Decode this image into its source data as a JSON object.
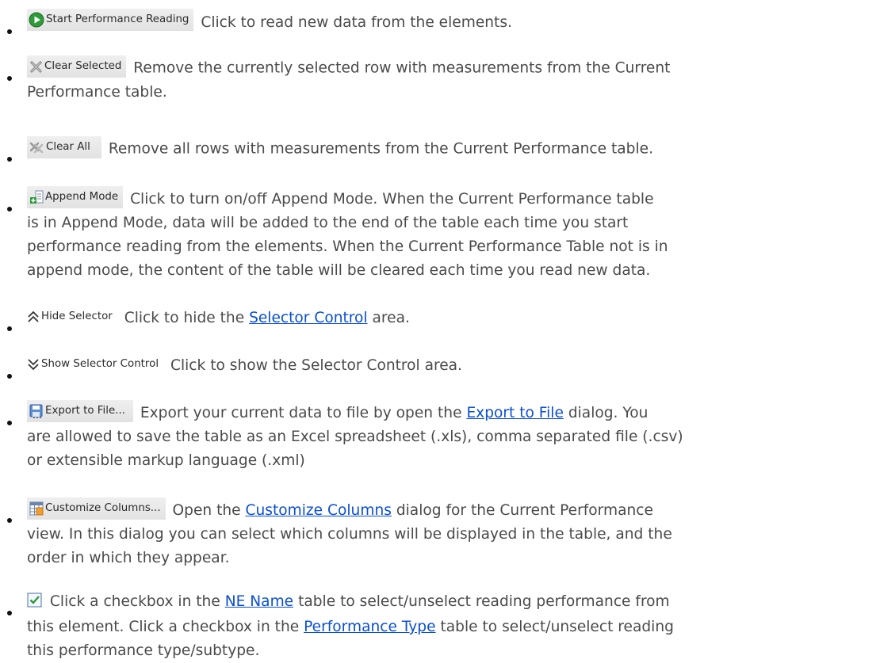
{
  "items": [
    {
      "icon": "play-circle-icon",
      "button_label": "Start Performance Reading",
      "desc": "Click to read new data from the elements."
    },
    {
      "icon": "clear-x-icon",
      "button_label": "Clear Selected",
      "desc_line1": "Remove the currently selected row with measurements from the Current",
      "desc_line2": "Performance table."
    },
    {
      "icon": "clear-all-icon",
      "button_label": "Clear All",
      "desc": "Remove all rows with measurements from the Current Performance table."
    },
    {
      "icon": "append-mode-icon",
      "button_label": "Append Mode",
      "desc_line1": "Click to turn on/off Append Mode. When the Current Performance table",
      "desc_line2": "is in Append Mode, data will be added to the end of the table each time you start",
      "desc_line3": "performance reading from the elements. When the Current Performance Table not is in",
      "desc_line4": "append mode, the content of the table will be cleared each time you read new data."
    },
    {
      "icon": "chevron-double-up-icon",
      "button_label": "Hide Selector",
      "desc_before": "Click to hide the",
      "link": "Selector Control",
      "desc_after": "area."
    },
    {
      "icon": "chevron-double-down-icon",
      "button_label": "Show Selector Control",
      "desc": "Click to show the Selector Control area."
    },
    {
      "icon": "save-disk-icon",
      "button_label": "Export to File...",
      "desc_before": "Export your current data to file by open the",
      "link": "Export to File",
      "desc_after": "dialog. You",
      "desc_line2": "are allowed to save the table as an Excel spreadsheet (.xls), comma separated file (.csv)",
      "desc_line3": "or extensible markup language (.xml)"
    },
    {
      "icon": "table-columns-icon",
      "button_label": "Customize Columns...",
      "desc_before": "Open the",
      "link": "Customize Columns",
      "desc_after": "dialog for the Current Performance",
      "desc_line2": "view. In this dialog you can select which columns will be displayed in the table, and the",
      "desc_line3": "order in which they appear."
    },
    {
      "icon": "checkbox-checked-icon",
      "desc_before": "Click a checkbox in the",
      "link": "NE Name",
      "desc_after": "table to select/unselect reading performance from",
      "desc_line2_before": "this element. Click a checkbox in the",
      "link2": "Performance Type",
      "desc_line2_after": "table to select/unselect reading",
      "desc_line3": "this performance type/subtype."
    }
  ]
}
